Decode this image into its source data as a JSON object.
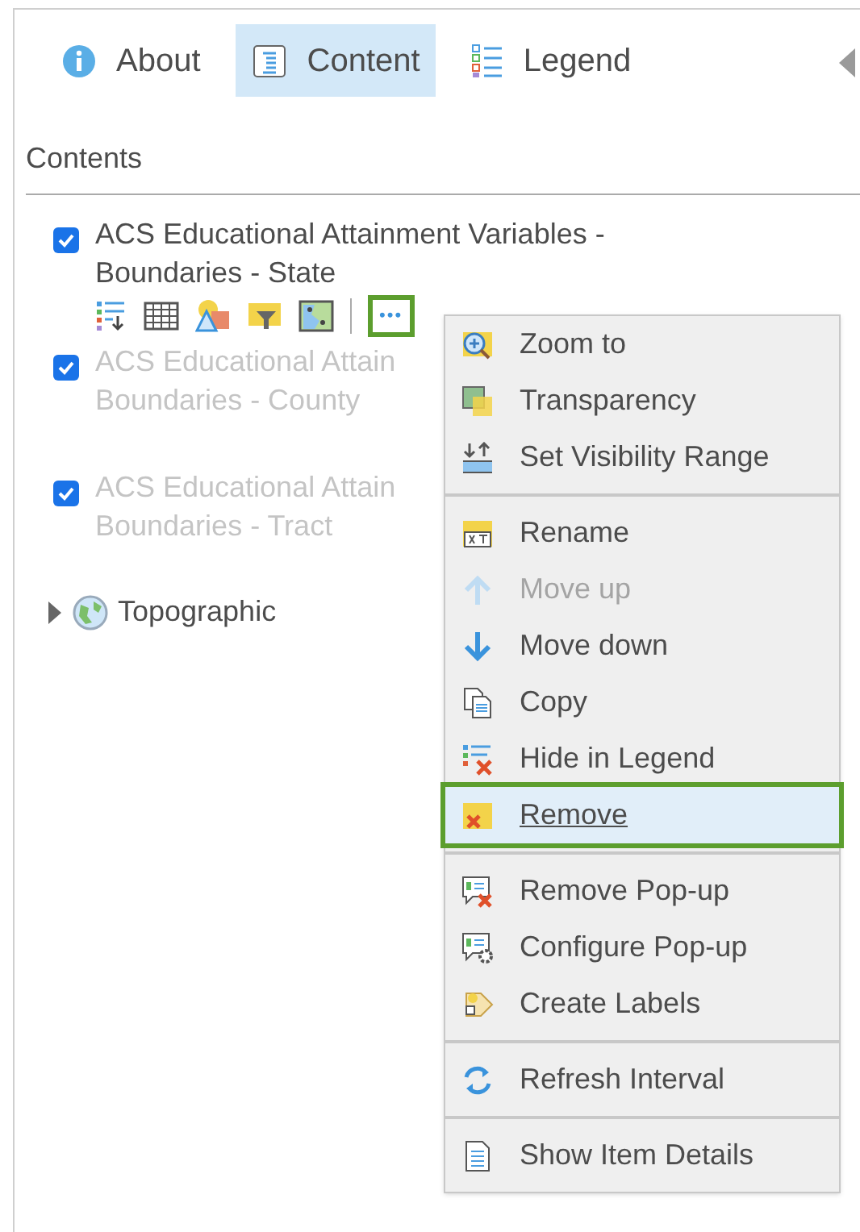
{
  "tabs": [
    {
      "label": "About",
      "selected": false
    },
    {
      "label": "Content",
      "selected": true
    },
    {
      "label": "Legend",
      "selected": false
    }
  ],
  "heading": "Contents",
  "layers": [
    {
      "title": "ACS Educational Attainment Variables -",
      "subtitle": "Boundaries - State",
      "checked": true,
      "in_range": true,
      "tools": true
    },
    {
      "title": "ACS Educational Attain",
      "subtitle": "Boundaries - County",
      "checked": true,
      "in_range": false,
      "tools": false
    },
    {
      "title": "ACS Educational Attain",
      "subtitle": "Boundaries - Tract",
      "checked": true,
      "in_range": false,
      "tools": false
    }
  ],
  "basemap": {
    "label": "Topographic",
    "expanded": false
  },
  "more_button": {
    "label": "•••",
    "selected": true
  },
  "menu": [
    [
      {
        "label": "Zoom to",
        "disabled": false,
        "selected": false
      },
      {
        "label": "Transparency",
        "disabled": false,
        "selected": false
      },
      {
        "label": "Set Visibility Range",
        "disabled": false,
        "selected": false
      }
    ],
    [
      {
        "label": "Rename",
        "disabled": false,
        "selected": false
      },
      {
        "label": "Move up",
        "disabled": true,
        "selected": false
      },
      {
        "label": "Move down",
        "disabled": false,
        "selected": false
      },
      {
        "label": "Copy",
        "disabled": false,
        "selected": false
      },
      {
        "label": "Hide in Legend",
        "disabled": false,
        "selected": false
      },
      {
        "label": "Remove",
        "disabled": false,
        "selected": true
      }
    ],
    [
      {
        "label": "Remove Pop-up",
        "disabled": false,
        "selected": false
      },
      {
        "label": "Configure Pop-up",
        "disabled": false,
        "selected": false
      },
      {
        "label": "Create Labels",
        "disabled": false,
        "selected": false
      }
    ],
    [
      {
        "label": "Refresh Interval",
        "disabled": false,
        "selected": false
      }
    ],
    [
      {
        "label": "Show Item Details",
        "disabled": false,
        "selected": false
      }
    ]
  ]
}
